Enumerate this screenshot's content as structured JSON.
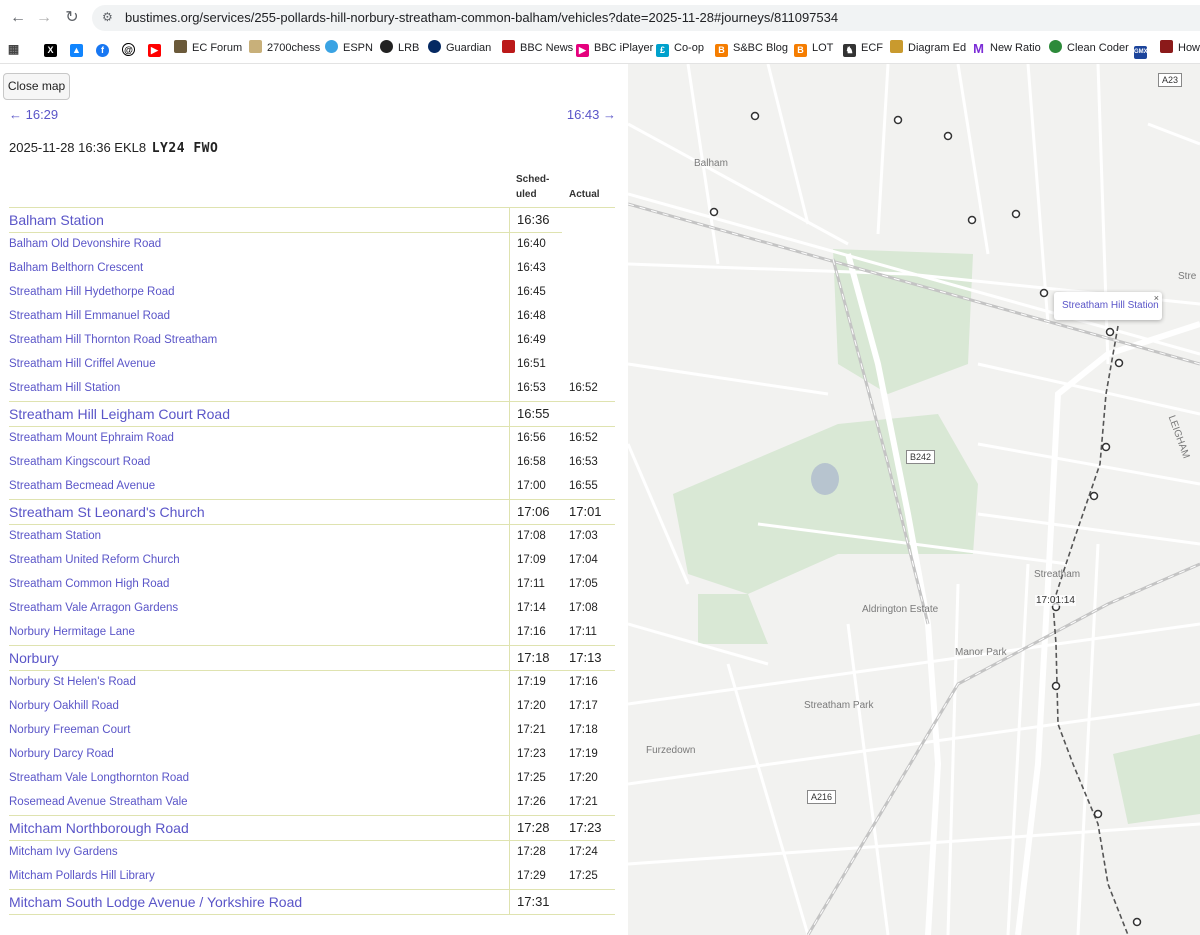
{
  "browser": {
    "url": "bustimes.org/services/255-pollards-hill-norbury-streatham-common-balham/vehicles?date=2025-11-28#journeys/811097534",
    "bookmarks": [
      "EC Forum",
      "2700chess",
      "ESPN",
      "LRB",
      "Guardian",
      "BBC News",
      "BBC iPlayer",
      "Co-op",
      "S&BC Blog",
      "LOT",
      "ECF",
      "Diagram Ed",
      "New Ratio",
      "Clean Coder",
      "How"
    ]
  },
  "page": {
    "close_map": "Close map",
    "prev_trip": "← 16:29",
    "next_trip": "16:43 →",
    "journey_info": "2025-11-28 16:36 EKL8",
    "registration": "LY24 FWO",
    "col_scheduled_1": "Sched-",
    "col_scheduled_2": "uled",
    "col_actual": "Actual"
  },
  "stops": [
    {
      "name": "Balham Station",
      "scheduled": "16:36",
      "actual": "",
      "major": true
    },
    {
      "name": "Balham Old Devonshire Road",
      "scheduled": "16:40",
      "actual": "",
      "major": false
    },
    {
      "name": "Balham Belthorn Crescent",
      "scheduled": "16:43",
      "actual": "",
      "major": false
    },
    {
      "name": "Streatham Hill Hydethorpe Road",
      "scheduled": "16:45",
      "actual": "",
      "major": false
    },
    {
      "name": "Streatham Hill Emmanuel Road",
      "scheduled": "16:48",
      "actual": "",
      "major": false
    },
    {
      "name": "Streatham Hill Thornton Road Streatham",
      "scheduled": "16:49",
      "actual": "",
      "major": false
    },
    {
      "name": "Streatham Hill Criffel Avenue",
      "scheduled": "16:51",
      "actual": "",
      "major": false
    },
    {
      "name": "Streatham Hill Station",
      "scheduled": "16:53",
      "actual": "16:52",
      "major": false
    },
    {
      "name": "Streatham Hill Leigham Court Road",
      "scheduled": "16:55",
      "actual": "",
      "major": true
    },
    {
      "name": "Streatham Mount Ephraim Road",
      "scheduled": "16:56",
      "actual": "16:52",
      "major": false
    },
    {
      "name": "Streatham Kingscourt Road",
      "scheduled": "16:58",
      "actual": "16:53",
      "major": false
    },
    {
      "name": "Streatham Becmead Avenue",
      "scheduled": "17:00",
      "actual": "16:55",
      "major": false
    },
    {
      "name": "Streatham St Leonard's Church",
      "scheduled": "17:06",
      "actual": "17:01",
      "major": true
    },
    {
      "name": "Streatham Station",
      "scheduled": "17:08",
      "actual": "17:03",
      "major": false
    },
    {
      "name": "Streatham United Reform Church",
      "scheduled": "17:09",
      "actual": "17:04",
      "major": false
    },
    {
      "name": "Streatham Common High Road",
      "scheduled": "17:11",
      "actual": "17:05",
      "major": false
    },
    {
      "name": "Streatham Vale Arragon Gardens",
      "scheduled": "17:14",
      "actual": "17:08",
      "major": false
    },
    {
      "name": "Norbury Hermitage Lane",
      "scheduled": "17:16",
      "actual": "17:11",
      "major": false
    },
    {
      "name": "Norbury",
      "scheduled": "17:18",
      "actual": "17:13",
      "major": true
    },
    {
      "name": "Norbury St Helen's Road",
      "scheduled": "17:19",
      "actual": "17:16",
      "major": false
    },
    {
      "name": "Norbury Oakhill Road",
      "scheduled": "17:20",
      "actual": "17:17",
      "major": false
    },
    {
      "name": "Norbury Freeman Court",
      "scheduled": "17:21",
      "actual": "17:18",
      "major": false
    },
    {
      "name": "Norbury Darcy Road",
      "scheduled": "17:23",
      "actual": "17:19",
      "major": false
    },
    {
      "name": "Streatham Vale Longthornton Road",
      "scheduled": "17:25",
      "actual": "17:20",
      "major": false
    },
    {
      "name": "Rosemead Avenue Streatham Vale",
      "scheduled": "17:26",
      "actual": "17:21",
      "major": false
    },
    {
      "name": "Mitcham Northborough Road",
      "scheduled": "17:28",
      "actual": "17:23",
      "major": true
    },
    {
      "name": "Mitcham Ivy Gardens",
      "scheduled": "17:28",
      "actual": "17:24",
      "major": false
    },
    {
      "name": "Mitcham Pollards Hill Library",
      "scheduled": "17:29",
      "actual": "17:25",
      "major": false
    },
    {
      "name": "Mitcham South Lodge Avenue / Yorkshire Road",
      "scheduled": "17:31",
      "actual": "",
      "major": true
    }
  ],
  "map": {
    "popup_label": "Streatham Hill Station",
    "popup_close": "×",
    "time_label": "17:01:14",
    "labels": [
      "Balham",
      "Streatham",
      "Aldrington Estate",
      "Manor Park",
      "Streatham Park",
      "Furzedown",
      "LEIGHAM",
      "Stre"
    ],
    "road_shields": [
      "A23",
      "B242",
      "A216"
    ],
    "colors": {
      "park": "#d9e8d5",
      "road": "#ffffff",
      "accent": "#5a55c8"
    }
  }
}
